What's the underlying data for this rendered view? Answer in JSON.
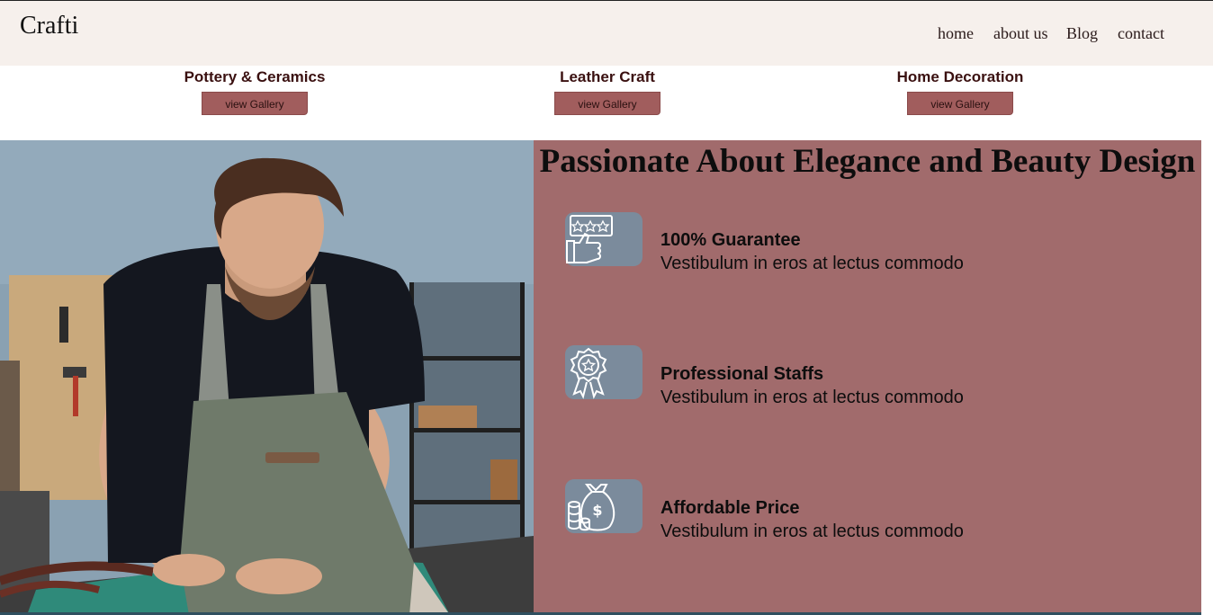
{
  "header": {
    "brand": "Crafti",
    "nav": [
      "home",
      "about us",
      "Blog",
      "contact"
    ]
  },
  "categories": [
    {
      "title": "Pottery & Ceramics",
      "button": "view Gallery"
    },
    {
      "title": "Leather Craft",
      "button": "view Gallery"
    },
    {
      "title": "Home Decoration",
      "button": "view Gallery"
    }
  ],
  "hero": {
    "headline": "Passionate About Elegance and Beauty Design",
    "features": [
      {
        "icon": "review-thumbs-up-icon",
        "title": "100% Guarantee",
        "desc": "Vestibulum in eros at lectus commodo"
      },
      {
        "icon": "award-badge-icon",
        "title": "Professional Staffs",
        "desc": "Vestibulum in eros at lectus commodo"
      },
      {
        "icon": "money-bag-icon",
        "title": "Affordable Price",
        "desc": "Vestibulum in eros at lectus commodo"
      }
    ]
  },
  "colors": {
    "header_bg": "#f6f0ec",
    "button_bg": "#a15d5d",
    "panel_bg": "#a16b6c",
    "icon_tile": "#7b8b9c"
  }
}
